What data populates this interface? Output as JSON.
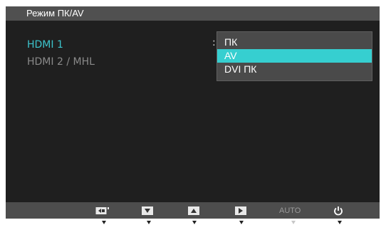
{
  "osd": {
    "title": "Режим ПК/AV",
    "inputs": [
      {
        "label": "HDMI 1",
        "state": "active"
      },
      {
        "label": "HDMI 2 / MHL",
        "state": "inactive"
      }
    ],
    "separator": ":",
    "dropdown": {
      "options": [
        "ПК",
        "AV",
        "DVI ПК"
      ],
      "selected": "AV"
    }
  },
  "button_bar": {
    "buttons": [
      {
        "name": "source-icon"
      },
      {
        "name": "down-arrow-icon"
      },
      {
        "name": "up-arrow-icon"
      },
      {
        "name": "right-arrow-icon"
      },
      {
        "name": "auto",
        "label": "AUTO"
      },
      {
        "name": "power-icon"
      }
    ]
  },
  "colors": {
    "accent": "#36cfd0",
    "active_text": "#3cc4cc",
    "osd_bg": "#1f1f1f",
    "title_bg": "#505050",
    "bar_bg": "#4d4d4d"
  }
}
